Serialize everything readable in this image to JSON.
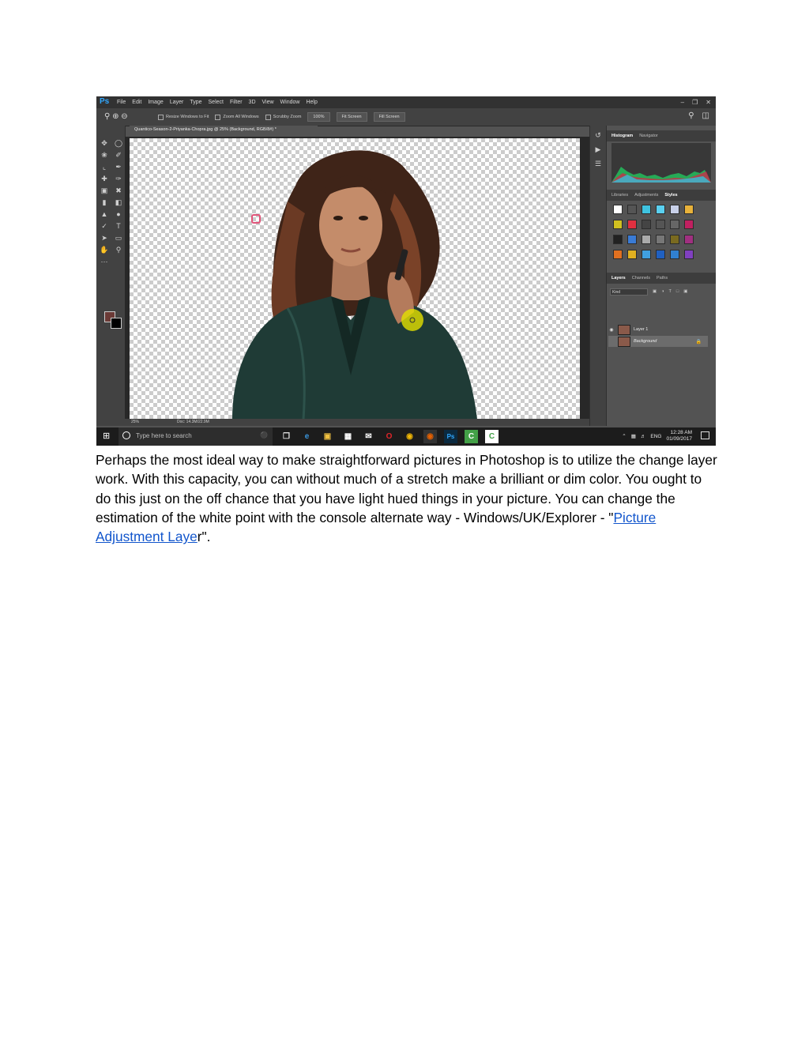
{
  "screenshot": {
    "app_logo": "Ps",
    "menu": [
      "File",
      "Edit",
      "Image",
      "Layer",
      "Type",
      "Select",
      "Filter",
      "3D",
      "View",
      "Window",
      "Help"
    ],
    "options": {
      "resize_windows": "Resize Windows to Fit",
      "zoom_all": "Zoom All Windows",
      "scrubby": "Scrubby Zoom",
      "zoom_100": "100%",
      "fit_screen": "Fit Screen",
      "fill_screen": "Fill Screen"
    },
    "document_tab": "Quantico-Season-2-Priyanka-Chopra.jpg @ 25% (Background, RGB/8#) *",
    "status": {
      "zoom": "25%",
      "doc": "Doc: 14.3M/22.9M"
    },
    "panel_tabs_top": [
      "Histogram",
      "Navigator"
    ],
    "panel_tabs_mid": [
      "Libraries",
      "Adjustments",
      "Styles"
    ],
    "panel_tabs_layers": [
      "Layers",
      "Channels",
      "Paths"
    ],
    "layers_kind": "Kind",
    "layers": [
      "Layer 1",
      "Background"
    ],
    "taskbar": {
      "search_placeholder": "Type here to search",
      "lang": "ENG",
      "time": "12:28 AM",
      "date": "01/09/2017"
    }
  },
  "paragraph": {
    "text_before": "Perhaps the most ideal way to make straightforward pictures in Photoshop is to utilize the change layer work. With this capacity, you can without much of a stretch make a brilliant or dim color. You ought to do this just on the off chance that you have light hued things in your picture. You can change the estimation of the white point with the console alternate way - Windows/UK/Explorer - \"",
    "link_text": "Picture Adjustment Laye",
    "text_after": "r\"."
  },
  "colors": {
    "link": "#1155cc",
    "ps_blue": "#31a8ff",
    "jacket": "#1f3b36",
    "hair": "#4a2a1c"
  }
}
